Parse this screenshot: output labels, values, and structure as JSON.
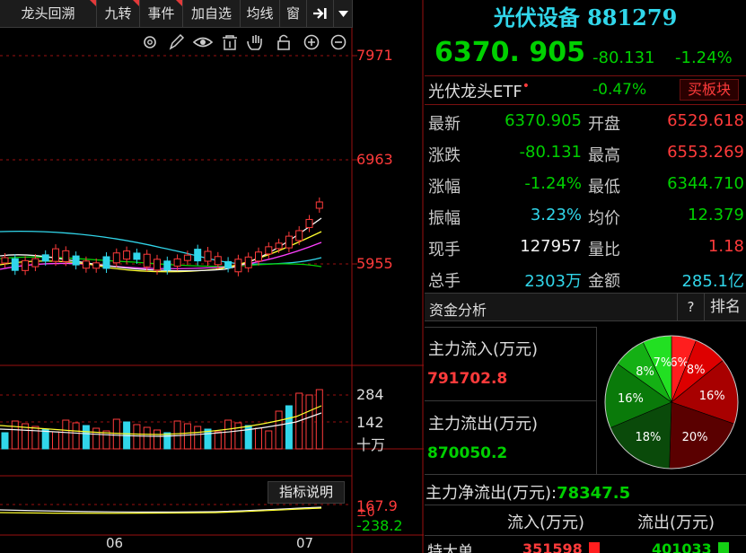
{
  "toolbar": {
    "tabs": [
      {
        "label": "龙头回溯",
        "flag": true
      },
      {
        "label": "九转",
        "flag": true
      },
      {
        "label": "事件",
        "flag": true
      },
      {
        "label": "加自选",
        "flag": false
      },
      {
        "label": "均线",
        "flag": false
      },
      {
        "label": "窗",
        "flag": false
      }
    ],
    "expand_icon": "expand-right-icon",
    "dropdown_icon": "dropdown-arrow-icon",
    "chart_tools": [
      "settings-icon",
      "pen-icon",
      "eye-icon",
      "trash-icon",
      "hand-icon",
      "lock-icon",
      "zoom-in-icon",
      "zoom-out-icon"
    ]
  },
  "chart": {
    "price_ticks": [
      "7971",
      "6963",
      "5955"
    ],
    "volume_ticks": [
      "284",
      "142",
      "十万"
    ],
    "indicator_button": "指标说明",
    "indicator_ticks": [
      "167.9",
      "±0",
      "-238.2"
    ],
    "date_ticks": [
      "06",
      "07"
    ],
    "colors": {
      "up": "#ff3b3b",
      "down": "#31d6ea",
      "ma5": "#f5f5f5",
      "ma10": "#ffff2e",
      "ma20": "#ff40ff",
      "ma30": "#00d000",
      "ma60": "#31d6ea",
      "axis": "#9a1010"
    }
  },
  "quote": {
    "title": "光伏设备 881279",
    "price": "6370. 905",
    "change": "-80.131",
    "change_pct": "-1.24%",
    "etf_name": "光伏龙头ETF",
    "etf_dot": "•",
    "etf_pct": "-0.47%",
    "buy_button": "买板块",
    "rows": [
      {
        "l1": "最新",
        "v1": "6370.905",
        "c1": "green",
        "l2": "开盘",
        "v2": "6529.618",
        "c2": "red"
      },
      {
        "l1": "涨跌",
        "v1": "-80.131",
        "c1": "green",
        "l2": "最高",
        "v2": "6553.269",
        "c2": "red"
      },
      {
        "l1": "涨幅",
        "v1": "-1.24%",
        "c1": "green",
        "l2": "最低",
        "v2": "6344.710",
        "c2": "green"
      },
      {
        "l1": "振幅",
        "v1": "3.23%",
        "c1": "cyan",
        "l2": "均价",
        "v2": "12.379",
        "c2": "green"
      },
      {
        "l1": "现手",
        "v1": "127957",
        "c1": "white",
        "l2": "量比",
        "v2": "1.18",
        "c2": "red"
      },
      {
        "l1": "总手",
        "v1": "2303万",
        "c1": "cyan",
        "l2": "金额",
        "v2": "285.1亿",
        "c2": "cyan"
      }
    ]
  },
  "funds": {
    "header": "资金分析",
    "help_button": "?",
    "rank_button": "排名",
    "inflow_label": "主力流入(万元)",
    "inflow_value": "791702.8",
    "outflow_label": "主力流出(万元)",
    "outflow_value": "870050.2",
    "net_label": "主力净流出(万元):",
    "net_value": "78347.5",
    "table_headers": [
      "流入(万元)",
      "流出(万元)"
    ],
    "first_row": {
      "label": "特大单",
      "inflow": "351598",
      "outflow": "401033"
    }
  },
  "chart_data": {
    "type": "pie",
    "slices": [
      {
        "label": "6%",
        "value": 6,
        "color": "#ff1e1e"
      },
      {
        "label": "8%",
        "value": 8,
        "color": "#dd0000"
      },
      {
        "label": "16%",
        "value": 16,
        "color": "#a80000"
      },
      {
        "label": "20%",
        "value": 20,
        "color": "#5a0000"
      },
      {
        "label": "18%",
        "value": 18,
        "color": "#0a4a0a"
      },
      {
        "label": "16%",
        "value": 16,
        "color": "#0a7a0a"
      },
      {
        "label": "8%",
        "value": 8,
        "color": "#14b014"
      },
      {
        "label": "7%",
        "value": 7,
        "color": "#22e022"
      }
    ]
  }
}
